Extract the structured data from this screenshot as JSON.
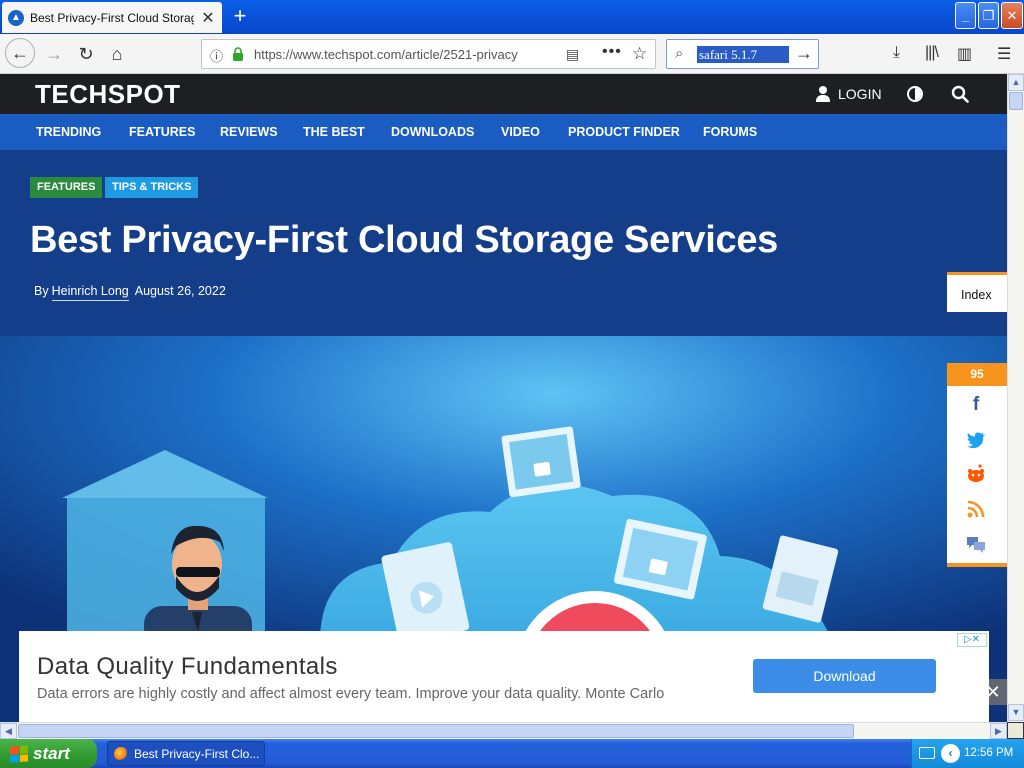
{
  "browser": {
    "tab_title": "Best Privacy-First Cloud Storage S",
    "new_tab_label": "+",
    "url": "https://www.techspot.com/article/2521-privacy",
    "search_value": "safari 5.1.7"
  },
  "site": {
    "logo": "TECHSPOT",
    "login_label": "LOGIN",
    "nav": [
      "TRENDING",
      "FEATURES",
      "REVIEWS",
      "THE BEST",
      "DOWNLOADS",
      "VIDEO",
      "PRODUCT FINDER",
      "FORUMS"
    ]
  },
  "article": {
    "tags": [
      "FEATURES",
      "TIPS & TRICKS"
    ],
    "title": "Best Privacy-First Cloud Storage Services",
    "by": "By",
    "author": "Heinrich Long",
    "date": "August 26, 2022"
  },
  "rail": {
    "index_label": "Index",
    "share_count": "95",
    "share_icons": [
      "facebook-icon",
      "twitter-icon",
      "reddit-icon",
      "rss-icon",
      "comments-icon"
    ]
  },
  "ad": {
    "title": "Data Quality Fundamentals",
    "text": "Data errors are highly costly and affect almost every team. Improve your data quality. Monte Carlo",
    "button": "Download",
    "choices": "▷✕",
    "close": "✕"
  },
  "taskbar": {
    "start_label": "start",
    "window_item": "Best Privacy-First Clo...",
    "clock": "12:56 PM"
  },
  "colors": {
    "xp_blue": "#0a4fd6",
    "site_nav_blue": "#1a5cc2",
    "accent_orange": "#f7941d",
    "tag_green": "#2a8a3e",
    "tag_blue": "#1e9be0",
    "ad_button": "#3b8de8"
  }
}
